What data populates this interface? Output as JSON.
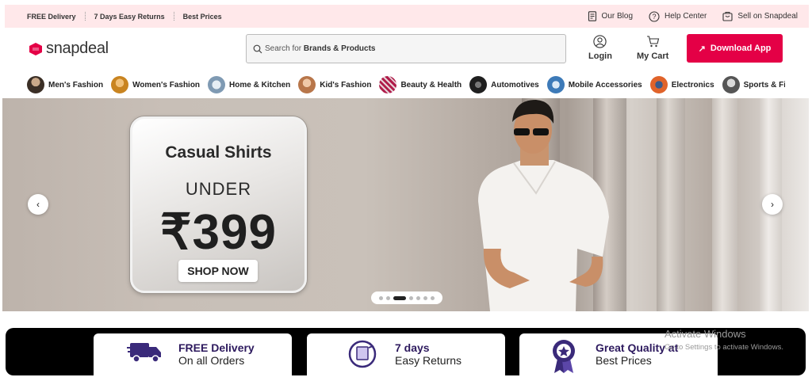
{
  "topbar": {
    "left": [
      "FREE Delivery",
      "7 Days Easy Returns",
      "Best Prices"
    ],
    "right": [
      {
        "label": "Our Blog",
        "icon": "document-icon"
      },
      {
        "label": "Help Center",
        "icon": "help-icon"
      },
      {
        "label": "Sell on Snapdeal",
        "icon": "shop-bag-icon"
      }
    ]
  },
  "header": {
    "logo": "snapdeal",
    "search_placeholder_prefix": "Search for ",
    "search_placeholder_bold": "Brands & Products",
    "login_label": "Login",
    "cart_label": "My Cart",
    "download_label": "Download App",
    "brand_color": "#e40046"
  },
  "categories": [
    {
      "label": "Men's Fashion",
      "color": "#4a3b2f"
    },
    {
      "label": "Women's Fashion",
      "color": "#d89a2a"
    },
    {
      "label": "Home & Kitchen",
      "color": "#8fa8c0"
    },
    {
      "label": "Kid's Fashion",
      "color": "#c98a5a"
    },
    {
      "label": "Beauty & Health",
      "color": "#b01c4a"
    },
    {
      "label": "Automotives",
      "color": "#2b2b2b"
    },
    {
      "label": "Mobile Accessories",
      "color": "#3d7ab8"
    },
    {
      "label": "Electronics",
      "color": "#e0632a"
    },
    {
      "label": "Sports & Fitness",
      "color": "#6b6b6b"
    }
  ],
  "banner": {
    "title": "Casual Shirts",
    "under": "UNDER",
    "price": "₹399",
    "cta": "SHOP NOW",
    "slides": 7,
    "active_slide": 3
  },
  "features": [
    {
      "line1": "FREE Delivery",
      "line2": "On all Orders"
    },
    {
      "line1": "7 days",
      "line2": "Easy Returns"
    },
    {
      "line1": "Great Quality at",
      "line2": "Best Prices"
    }
  ],
  "watermark": {
    "title": "Activate Windows",
    "subtitle": "Go to Settings to activate Windows."
  }
}
